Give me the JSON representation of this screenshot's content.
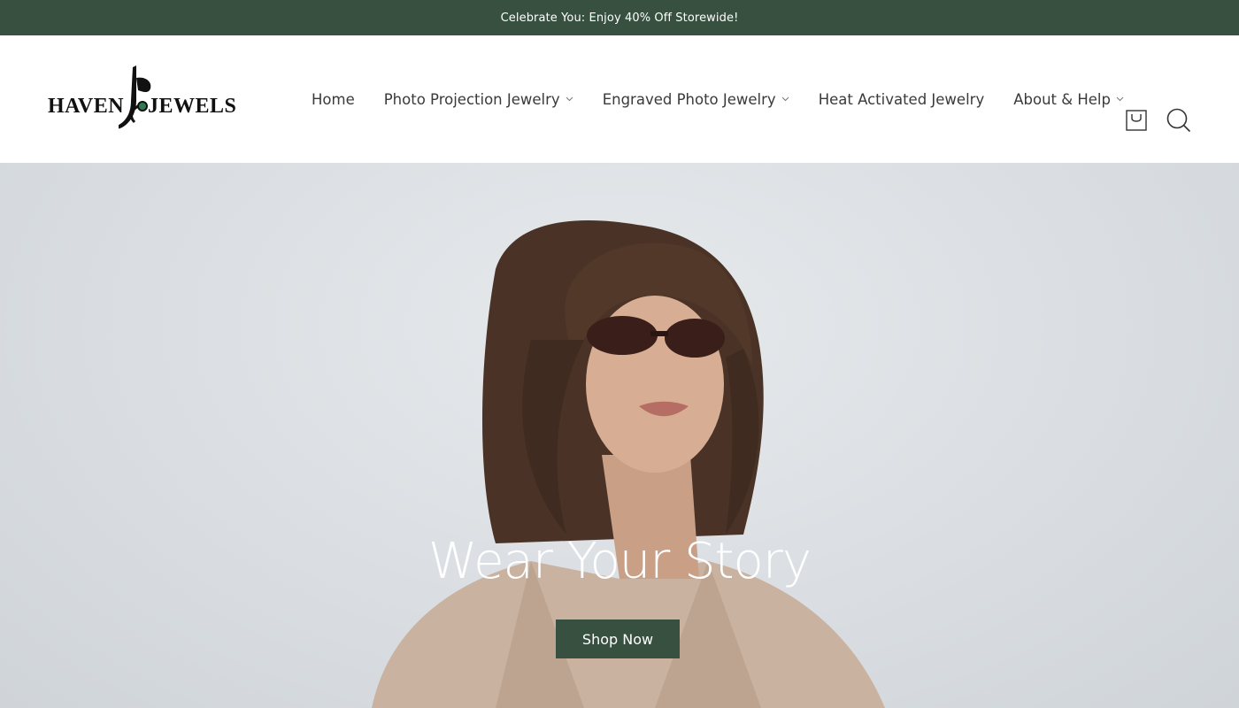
{
  "announcement": {
    "text": "Celebrate You: Enjoy 40% Off Storewide!"
  },
  "brand": {
    "logo_left": "HAVEN",
    "logo_right": "JEWELS",
    "logo_icon": "jewel-logo-mark"
  },
  "nav": {
    "items": [
      {
        "label": "Home",
        "dropdown": false
      },
      {
        "label": "Photo Projection Jewelry",
        "dropdown": true
      },
      {
        "label": "Engraved Photo Jewelry",
        "dropdown": true
      },
      {
        "label": "Heat Activated Jewelry",
        "dropdown": false
      },
      {
        "label": "About & Help",
        "dropdown": true
      }
    ]
  },
  "header_icons": {
    "cart": "shopping-bag-icon",
    "search": "search-icon"
  },
  "hero": {
    "title": "Wear Your Story",
    "cta_label": "Shop Now",
    "image": "woman-in-sunglasses-photo"
  },
  "colors": {
    "accent": "#37503f",
    "hero_bg": "#dcdfe2",
    "text": "#3a3a3a"
  }
}
